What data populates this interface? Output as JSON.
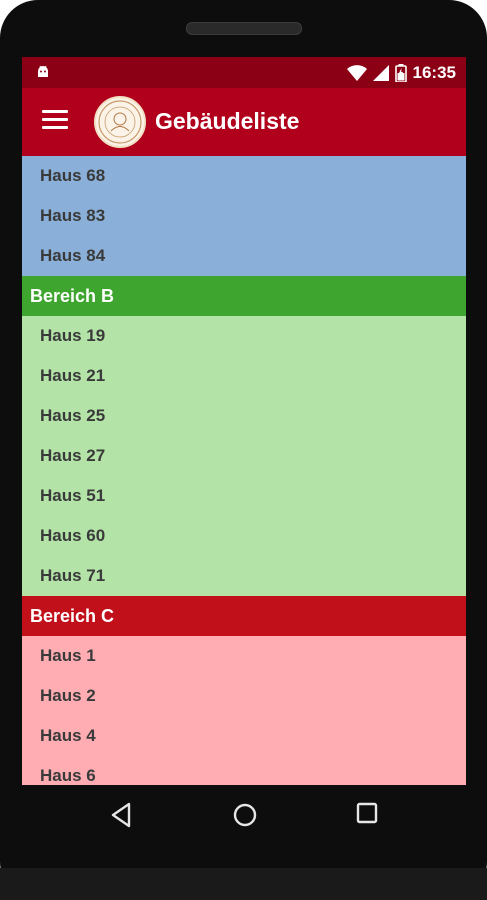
{
  "status_bar": {
    "time": "16:35",
    "icons": [
      "android-icon",
      "wifi-icon",
      "signal-icon",
      "battery-icon"
    ]
  },
  "app_bar": {
    "title": "Gebäudeliste",
    "menu_icon": "hamburger-menu-icon",
    "logo": "university-seal-logo"
  },
  "list": {
    "section_a_items": [
      {
        "label": "Haus 68"
      },
      {
        "label": "Haus 83"
      },
      {
        "label": "Haus 84"
      }
    ],
    "section_b": {
      "header": "Bereich B",
      "items": [
        {
          "label": "Haus 19"
        },
        {
          "label": "Haus 21"
        },
        {
          "label": "Haus 25"
        },
        {
          "label": "Haus 27"
        },
        {
          "label": "Haus 51"
        },
        {
          "label": "Haus 60"
        },
        {
          "label": "Haus 71"
        }
      ]
    },
    "section_c": {
      "header": "Bereich C",
      "items": [
        {
          "label": "Haus 1"
        },
        {
          "label": "Haus 2"
        },
        {
          "label": "Haus 4"
        },
        {
          "label": "Haus 6"
        }
      ]
    }
  },
  "colors": {
    "status_bar": "#8b0015",
    "app_bar": "#b0001c",
    "section_a_bg": "#8ab0d9",
    "section_b_header": "#3ea52e",
    "section_b_bg": "#b3e3a7",
    "section_c_header": "#c2101b",
    "section_c_bg": "#ffadb3"
  },
  "nav_bar": {
    "icons": [
      "back-icon",
      "home-icon",
      "recent-apps-icon"
    ]
  }
}
